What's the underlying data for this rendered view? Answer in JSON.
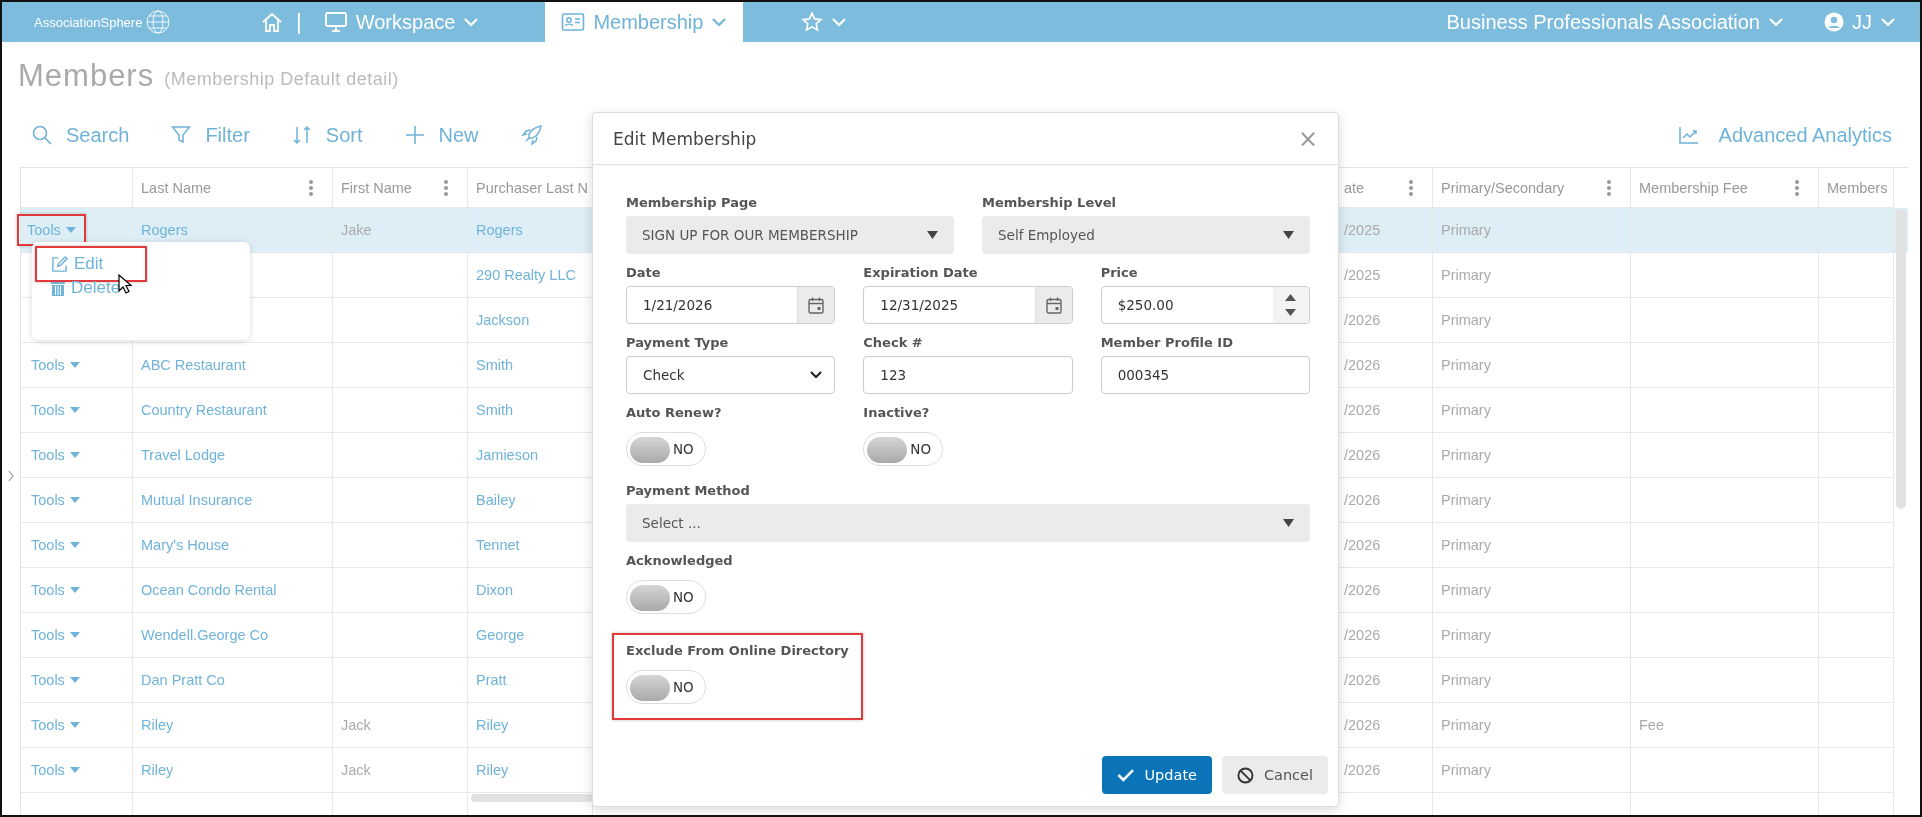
{
  "top_bar": {
    "logo": "AssociationSphere",
    "separator": "|",
    "nav": [
      {
        "kind": "menu",
        "label": "Workspace",
        "selected": false
      },
      {
        "kind": "menu",
        "label": "Membership",
        "selected": true
      },
      {
        "kind": "favorites",
        "selected": false
      }
    ],
    "organization": "Business Professionals Association",
    "user": "JJ"
  },
  "page": {
    "title": "Members",
    "subtitle": "(Membership Default detail)"
  },
  "toolbar": {
    "actions": [
      "Search",
      "Filter",
      "Sort",
      "New"
    ],
    "analytics": "Advanced Analytics"
  },
  "table": {
    "columns": [
      {
        "label": "Last Name",
        "menu": true
      },
      {
        "label": "First Name",
        "menu": true
      },
      {
        "label": "Purchaser Last N",
        "menu": false
      },
      {
        "label": "ate",
        "menu": true
      },
      {
        "label": "Primary/Secondary",
        "menu": true
      },
      {
        "label": "Membership Fee",
        "menu": true
      },
      {
        "label": "Members",
        "menu": false
      }
    ],
    "rows": [
      {
        "selected": true,
        "tools": {
          "label": "Tools",
          "highlighted": true
        },
        "last_name": "Rogers",
        "first_name": "Jake",
        "purchaser": "Rogers",
        "date": "/2025",
        "role": "Primary"
      },
      {
        "selected": false,
        "purchaser": "290 Realty LLC",
        "date": "/2025",
        "role": "Primary"
      },
      {
        "selected": false,
        "purchaser": "Jackson",
        "date": "/2026",
        "role": "Primary"
      },
      {
        "selected": false,
        "tools": {
          "label": "Tools",
          "highlighted": false
        },
        "last_name": "ABC Restaurant",
        "purchaser": "Smith",
        "date": "/2026",
        "role": "Primary"
      },
      {
        "selected": false,
        "tools": {
          "label": "Tools",
          "highlighted": false
        },
        "last_name": "Country Restaurant",
        "purchaser": "Smith",
        "date": "/2026",
        "role": "Primary"
      },
      {
        "selected": false,
        "tools": {
          "label": "Tools",
          "highlighted": false
        },
        "last_name": "Travel Lodge",
        "purchaser": "Jamieson",
        "date": "/2026",
        "role": "Primary"
      },
      {
        "selected": false,
        "tools": {
          "label": "Tools",
          "highlighted": false
        },
        "last_name": "Mutual Insurance",
        "purchaser": "Bailey",
        "date": "/2026",
        "role": "Primary"
      },
      {
        "selected": false,
        "tools": {
          "label": "Tools",
          "highlighted": false
        },
        "last_name": "Mary's House",
        "purchaser": "Tennet",
        "date": "/2026",
        "role": "Primary"
      },
      {
        "selected": false,
        "tools": {
          "label": "Tools",
          "highlighted": false
        },
        "last_name": "Ocean Condo Rental",
        "purchaser": "Dixon",
        "date": "/2026",
        "role": "Primary"
      },
      {
        "selected": false,
        "tools": {
          "label": "Tools",
          "highlighted": false
        },
        "last_name": "Wendell.George Co",
        "purchaser": "George",
        "date": "/2026",
        "role": "Primary"
      },
      {
        "selected": false,
        "tools": {
          "label": "Tools",
          "highlighted": false
        },
        "last_name": "Dan Pratt Co",
        "purchaser": "Pratt",
        "date": "/2026",
        "role": "Primary"
      },
      {
        "selected": false,
        "tools": {
          "label": "Tools",
          "highlighted": false
        },
        "last_name": "Riley",
        "first_name": "Jack",
        "purchaser": "Riley",
        "date": "/2026",
        "role": "Primary",
        "fee": "Fee"
      },
      {
        "selected": false,
        "tools": {
          "label": "Tools",
          "highlighted": false
        },
        "last_name": "Riley",
        "first_name": "Jack",
        "purchaser": "Riley",
        "date": "/2026",
        "role": "Primary"
      }
    ]
  },
  "row_menu": {
    "items": [
      {
        "label": "Edit",
        "highlighted": true
      },
      {
        "label": "Delete",
        "highlighted": false
      }
    ]
  },
  "modal": {
    "title": "Edit Membership",
    "close": "×",
    "rows": [
      [
        {
          "kind": "select",
          "label": "Membership Page",
          "value": "SIGN UP FOR OUR MEMBERSHIP",
          "highlighted": false
        },
        {
          "kind": "select",
          "label": "Membership Level",
          "value": "Self Employed",
          "highlighted": false
        }
      ],
      [
        {
          "kind": "date",
          "label": "Date",
          "value": "1/21/2026",
          "highlighted": false
        },
        {
          "kind": "date",
          "label": "Expiration Date",
          "value": "12/31/2025",
          "highlighted": false
        },
        {
          "kind": "number",
          "label": "Price",
          "value": "$250.00",
          "highlighted": false
        }
      ],
      [
        {
          "kind": "dropdown",
          "label": "Payment Type",
          "value": "Check",
          "highlighted": false
        },
        {
          "kind": "text",
          "label": "Check #",
          "value": "123",
          "highlighted": false
        },
        {
          "kind": "text",
          "label": "Member Profile ID",
          "value": "000345",
          "highlighted": false
        }
      ],
      [
        {
          "kind": "toggle",
          "label": "Auto Renew?",
          "on": false,
          "state": "NO",
          "highlighted": false
        },
        {
          "kind": "toggle",
          "label": "Inactive?",
          "on": false,
          "state": "NO",
          "highlighted": false
        }
      ],
      [
        {
          "kind": "select",
          "label": "Payment Method",
          "placeholder": "Select ...",
          "highlighted": false
        }
      ],
      [
        {
          "kind": "toggle",
          "label": "Acknowledged",
          "on": false,
          "state": "NO",
          "highlighted": false
        }
      ],
      [
        {
          "kind": "toggle",
          "label": "Exclude From Online Directory",
          "on": false,
          "state": "NO",
          "highlighted": true
        }
      ]
    ],
    "buttons": [
      {
        "kind": "primary",
        "label": "Update"
      },
      {
        "kind": "secondary",
        "label": "Cancel"
      }
    ]
  }
}
